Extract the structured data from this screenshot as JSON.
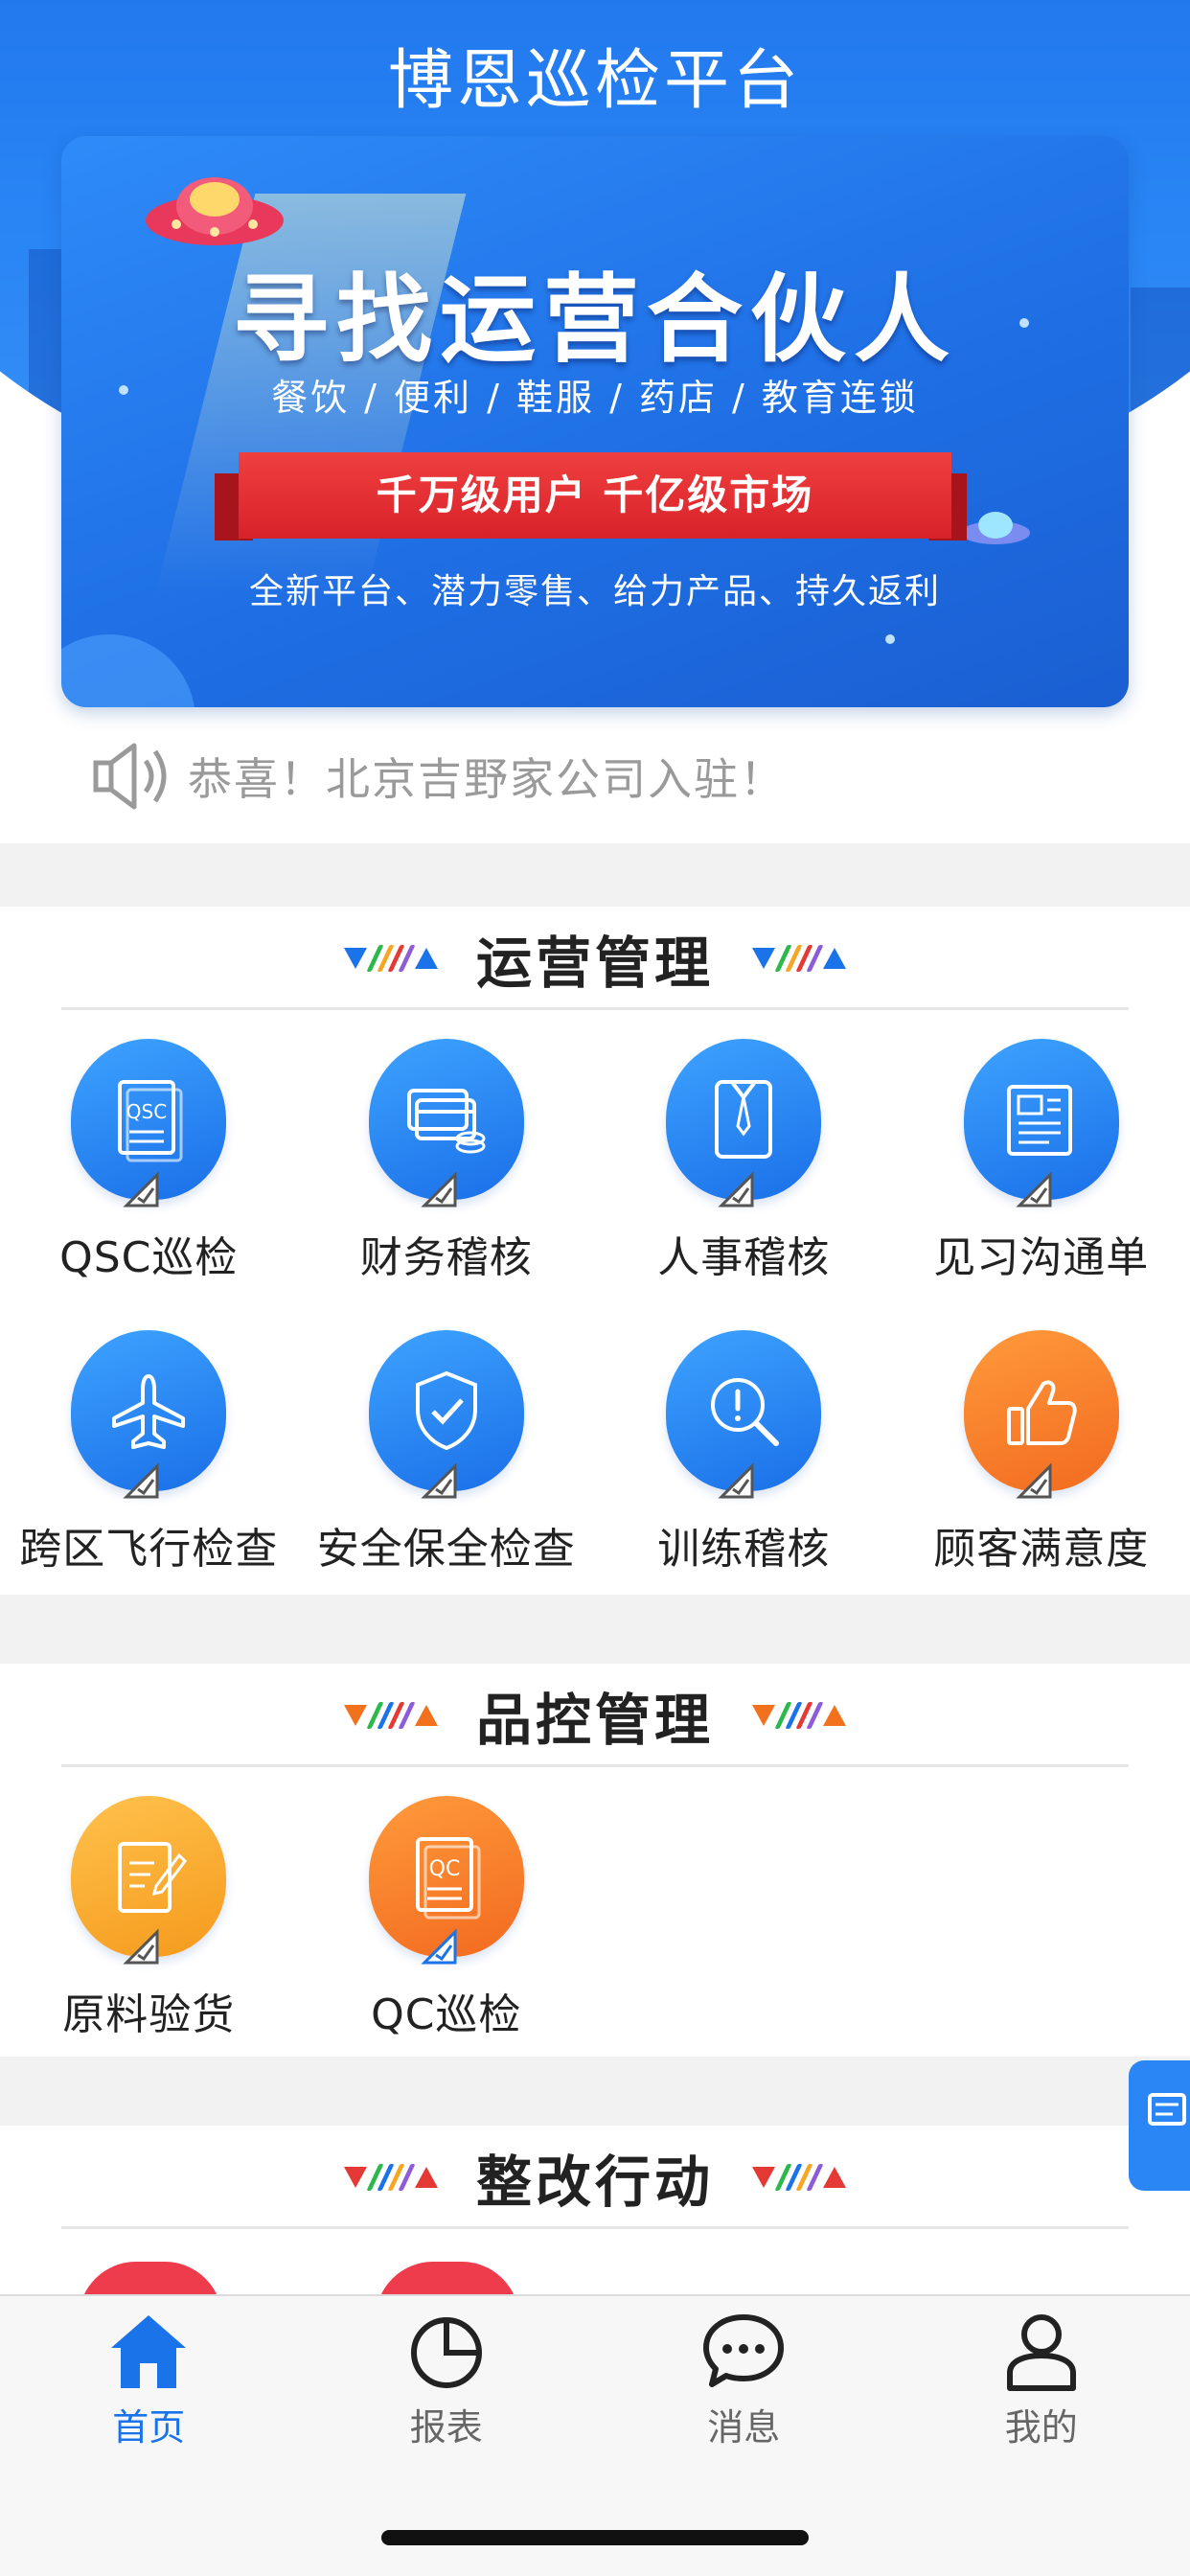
{
  "app": {
    "title": "博恩巡检平台"
  },
  "banner": {
    "headline": "寻找运营合伙人",
    "categories": "餐饮 / 便利 / 鞋服 / 药店 / 教育连锁",
    "ribbon": "千万级用户 千亿级市场",
    "subline": "全新平台、潜力零售、给力产品、持久返利"
  },
  "notice": {
    "icon": "speaker-icon",
    "text": "恭喜！北京吉野家公司入驻！"
  },
  "sections": [
    {
      "title": "运营管理",
      "accent": "#1a73e8",
      "items": [
        {
          "label": "QSC巡检",
          "icon": "qsc-document-icon",
          "color": "blue"
        },
        {
          "label": "财务稽核",
          "icon": "finance-cards-icon",
          "color": "blue"
        },
        {
          "label": "人事稽核",
          "icon": "personnel-shirt-icon",
          "color": "blue"
        },
        {
          "label": "见习沟通单",
          "icon": "newspaper-icon",
          "color": "blue"
        },
        {
          "label": "跨区飞行检查",
          "icon": "airplane-icon",
          "color": "blue"
        },
        {
          "label": "安全保全检查",
          "icon": "shield-check-icon",
          "color": "blue"
        },
        {
          "label": "训练稽核",
          "icon": "magnifier-icon",
          "color": "blue"
        },
        {
          "label": "顾客满意度",
          "icon": "thumbs-up-icon",
          "color": "orange"
        }
      ]
    },
    {
      "title": "品控管理",
      "accent": "#f2711c",
      "items": [
        {
          "label": "原料验货",
          "icon": "edit-document-icon",
          "color": "yellow"
        },
        {
          "label": "QC巡检",
          "icon": "qc-document-icon",
          "color": "orange"
        }
      ]
    },
    {
      "title": "整改行动",
      "accent": "#e53935",
      "items": []
    }
  ],
  "tabbar": {
    "tabs": [
      {
        "label": "首页",
        "icon": "home-icon",
        "active": true
      },
      {
        "label": "报表",
        "icon": "pie-chart-icon",
        "active": false
      },
      {
        "label": "消息",
        "icon": "chat-bubble-icon",
        "active": false
      },
      {
        "label": "我的",
        "icon": "user-icon",
        "active": false
      }
    ],
    "active_color": "#1a73e8"
  }
}
